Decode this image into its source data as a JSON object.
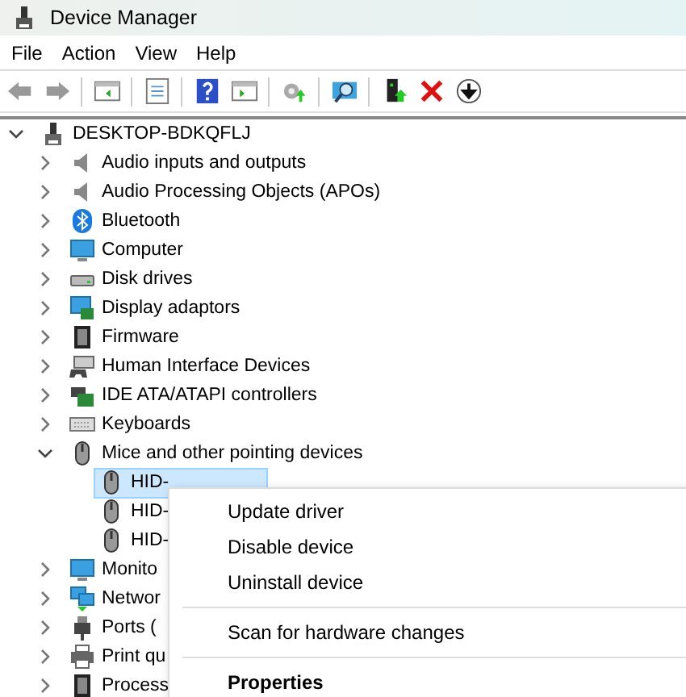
{
  "window": {
    "title": "Device Manager"
  },
  "menu_bar": [
    {
      "label": "File"
    },
    {
      "label": "Action"
    },
    {
      "label": "View"
    },
    {
      "label": "Help"
    }
  ],
  "tree": [
    {
      "label": "DESKTOP-BDKQFLJ",
      "kind": "pc",
      "expanded": true,
      "selected": false,
      "children": [
        {
          "label": "Audio inputs and outputs",
          "kind": "speaker",
          "expanded": false,
          "selected": false
        },
        {
          "label": "Audio Processing Objects (APOs)",
          "kind": "speaker",
          "expanded": false,
          "selected": false
        },
        {
          "label": "Bluetooth",
          "kind": "bluetooth",
          "expanded": false,
          "selected": false
        },
        {
          "label": "Computer",
          "kind": "monitor",
          "expanded": false,
          "selected": false
        },
        {
          "label": "Disk drives",
          "kind": "disk",
          "expanded": false,
          "selected": false
        },
        {
          "label": "Display adaptors",
          "kind": "display",
          "expanded": false,
          "selected": false
        },
        {
          "label": "Firmware",
          "kind": "chip",
          "expanded": false,
          "selected": false
        },
        {
          "label": "Human Interface Devices",
          "kind": "hid",
          "expanded": false,
          "selected": false
        },
        {
          "label": "IDE ATA/ATAPI controllers",
          "kind": "card",
          "expanded": false,
          "selected": false
        },
        {
          "label": "Keyboards",
          "kind": "keyboard",
          "expanded": false,
          "selected": false
        },
        {
          "label": "Mice and other pointing devices",
          "kind": "mouse",
          "expanded": true,
          "selected": false,
          "children": [
            {
              "label": "HID-",
              "kind": "mouse",
              "selected": true
            },
            {
              "label": "HID-",
              "kind": "mouse",
              "selected": false
            },
            {
              "label": "HID-",
              "kind": "mouse",
              "selected": false
            }
          ]
        },
        {
          "label": "Monito",
          "kind": "monitor",
          "expanded": false,
          "selected": false
        },
        {
          "label": "Networ",
          "kind": "network",
          "expanded": false,
          "selected": false
        },
        {
          "label": "Ports (",
          "kind": "port",
          "expanded": false,
          "selected": false
        },
        {
          "label": "Print qu",
          "kind": "printer",
          "expanded": false,
          "selected": false
        },
        {
          "label": "Process",
          "kind": "chip",
          "expanded": false,
          "selected": false
        }
      ]
    }
  ],
  "context_menu": {
    "groups": [
      [
        {
          "label": "Update driver",
          "default": false
        },
        {
          "label": "Disable device",
          "default": false
        },
        {
          "label": "Uninstall device",
          "default": false
        }
      ],
      [
        {
          "label": "Scan for hardware changes",
          "default": false
        }
      ],
      [
        {
          "label": "Properties",
          "default": true
        }
      ]
    ]
  }
}
